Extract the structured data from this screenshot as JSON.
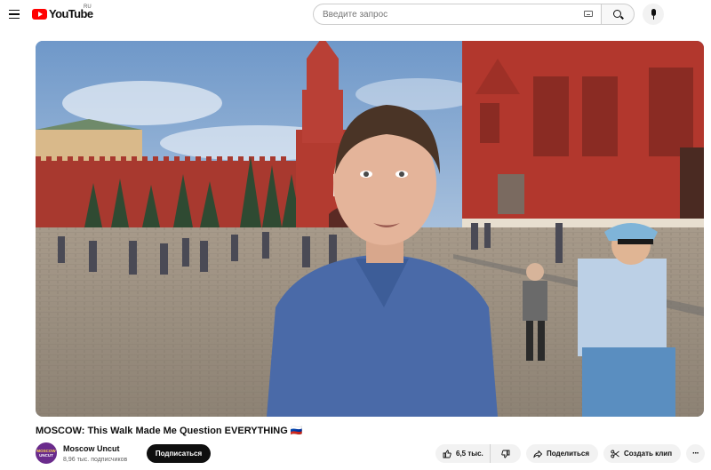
{
  "header": {
    "logo_text": "YouTube",
    "logo_region": "RU",
    "search_placeholder": "Введите запрос"
  },
  "video": {
    "title": "MOSCOW: This Walk Made Me Question EVERYTHING 🇷🇺",
    "channel": {
      "name": "Moscow Uncut",
      "subscribers": "8,96 тыс. подписчиков",
      "avatar_text_1": "MOSCOW",
      "avatar_text_2": "UNCUT"
    },
    "subscribe_label": "Подписаться",
    "likes": "6,5 тыс.",
    "share_label": "Поделиться",
    "clip_label": "Создать клип",
    "more_label": "···"
  },
  "icons": {
    "menu": "menu-icon",
    "search": "search-icon",
    "keyboard": "keyboard-icon",
    "mic": "mic-icon",
    "like": "thumbs-up-icon",
    "dislike": "thumbs-down-icon",
    "share": "share-arrow-icon",
    "clip": "scissors-icon",
    "more": "more-horizontal-icon"
  },
  "colors": {
    "brand_red": "#ff0000",
    "subscribe_bg": "#0f0f0f",
    "pill_bg": "#f2f2f2"
  }
}
